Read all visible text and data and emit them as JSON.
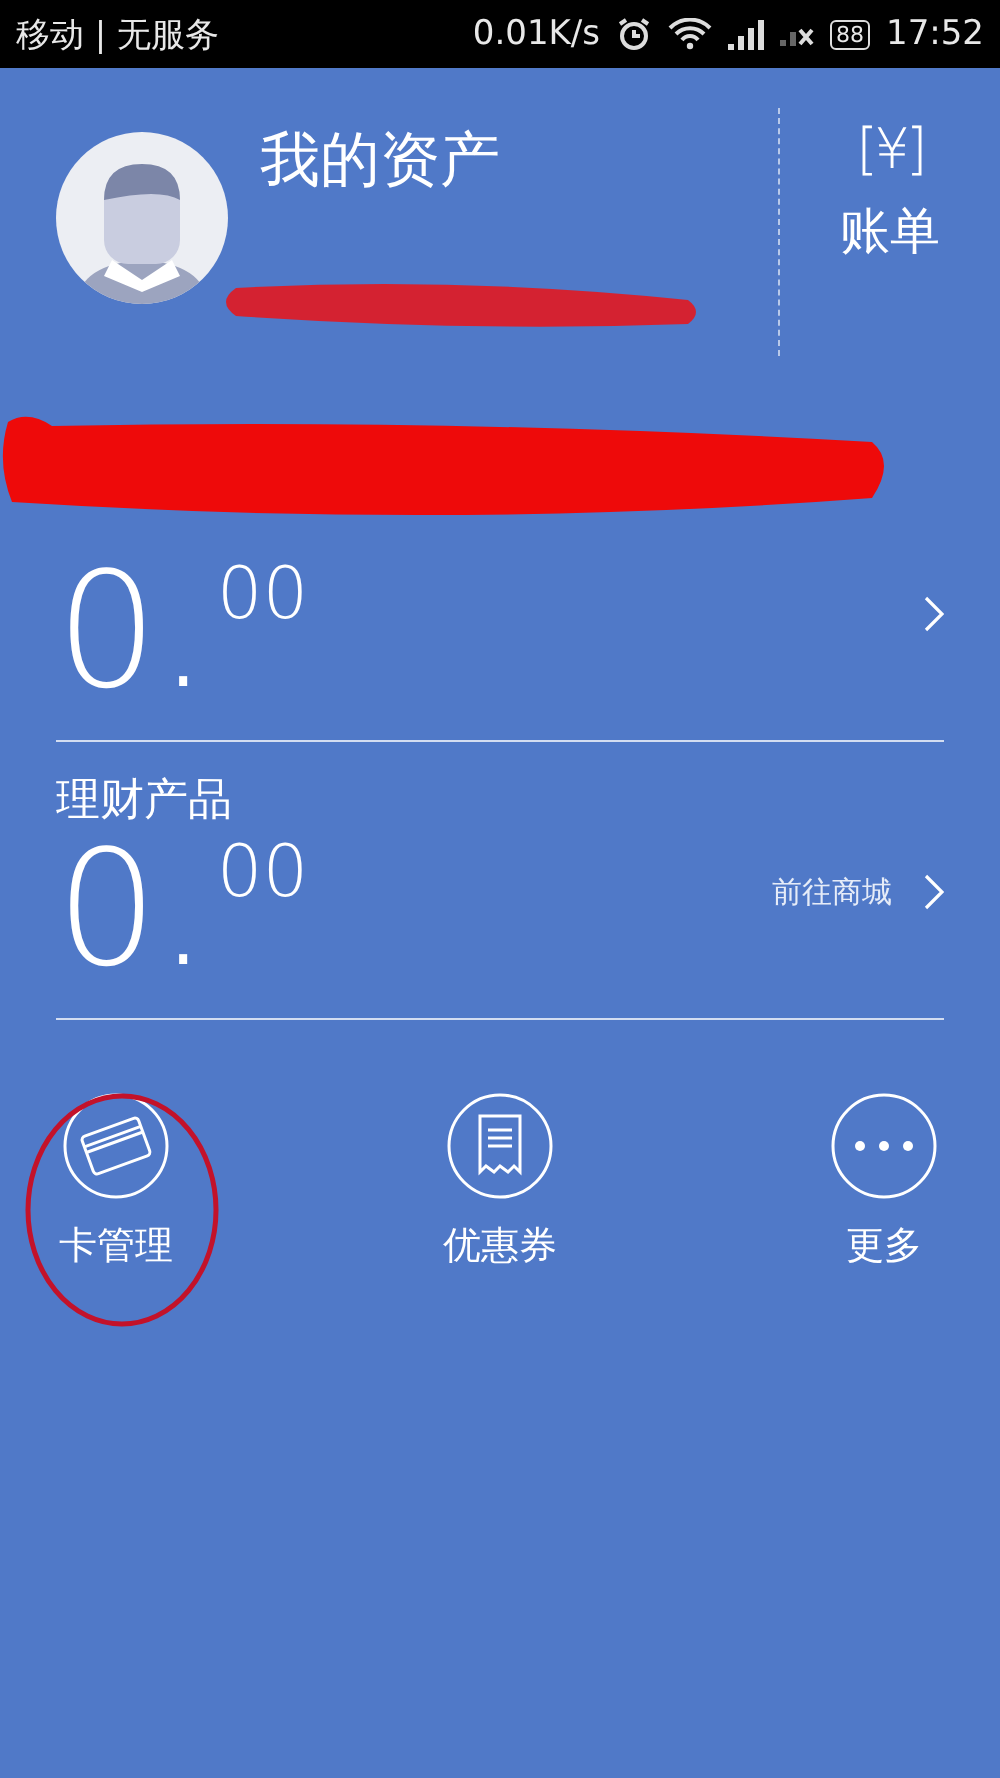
{
  "status_bar": {
    "carrier": "移动 | 无服务",
    "speed": "0.01K/s",
    "battery": "88",
    "time": "17:52"
  },
  "header": {
    "title": "我的资产",
    "bill_icon": "[¥]",
    "bill_label": "账单"
  },
  "balance": {
    "amount_int": "0.",
    "amount_dec": "00"
  },
  "products": {
    "title": "理财产品",
    "amount_int": "0.",
    "amount_dec": "00",
    "link": "前往商城"
  },
  "actions": [
    {
      "kind": "card",
      "label": "卡管理"
    },
    {
      "kind": "receipt",
      "label": "优惠券"
    },
    {
      "kind": "more",
      "label": "更多"
    }
  ],
  "annotations": [
    {
      "kind": "scribble-short"
    },
    {
      "kind": "scribble-long"
    },
    {
      "kind": "circle"
    }
  ]
}
